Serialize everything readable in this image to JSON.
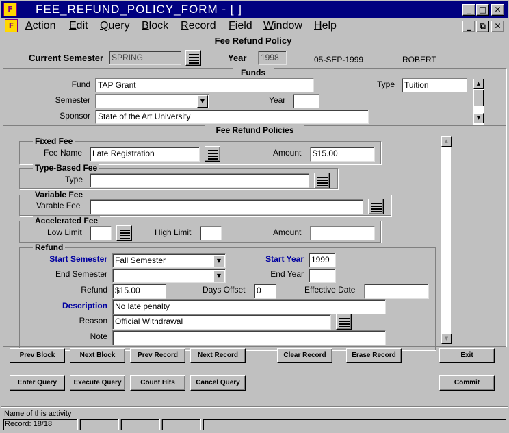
{
  "window": {
    "title": "FEE_REFUND_POLICY_FORM - [ ]",
    "icon_name": "oracle-forms-icon",
    "minimize": "_",
    "restore": "□",
    "close": "✕",
    "inner_restore": "⧉"
  },
  "menu": [
    "Action",
    "Edit",
    "Query",
    "Block",
    "Record",
    "Field",
    "Window",
    "Help"
  ],
  "form": {
    "title": "Fee Refund Policy",
    "current_semester_label": "Current Semester",
    "current_semester": "SPRING",
    "year_label": "Year",
    "year": "1998",
    "date": "05-SEP-1999",
    "user": "ROBERT"
  },
  "funds": {
    "header": "Funds",
    "fund_label": "Fund",
    "fund": "TAP Grant",
    "type_label": "Type",
    "type": "Tuition",
    "semester_label": "Semester",
    "semester": "",
    "year_label": "Year",
    "year": "",
    "sponsor_label": "Sponsor",
    "sponsor": "State of the Art University"
  },
  "policies": {
    "header": "Fee Refund Policies",
    "fixed_fee": {
      "title": "Fixed Fee",
      "fee_name_label": "Fee Name",
      "fee_name": "Late Registration",
      "amount_label": "Amount",
      "amount": "$15.00"
    },
    "type_based": {
      "title": "Type-Based Fee",
      "type_label": "Type",
      "type": ""
    },
    "variable": {
      "title": "Variable Fee",
      "label": "Varable Fee",
      "value": ""
    },
    "accelerated": {
      "title": "Accelerated Fee",
      "low_label": "Low Limit",
      "low": "",
      "high_label": "High Limit",
      "high": "",
      "amount_label": "Amount",
      "amount": ""
    },
    "refund": {
      "title": "Refund",
      "start_semester_label": "Start Semester",
      "start_semester": "Fall Semester",
      "start_year_label": "Start Year",
      "start_year": "1999",
      "end_semester_label": "End Semester",
      "end_semester": "",
      "end_year_label": "End Year",
      "end_year": "",
      "refund_label": "Refund",
      "refund": "$15.00",
      "days_offset_label": "Days Offset",
      "days_offset": "0",
      "effective_date_label": "Effective Date",
      "effective_date": "",
      "description_label": "Description",
      "description": "No late penalty",
      "reason_label": "Reason",
      "reason": "Official Withdrawal",
      "note_label": "Note",
      "note": ""
    }
  },
  "buttons": {
    "prev_block": "Prev Block",
    "next_block": "Next Block",
    "prev_record": "Prev Record",
    "next_record": "Next Record",
    "clear_record": "Clear Record",
    "erase_record": "Erase Record",
    "exit": "Exit",
    "enter_query": "Enter Query",
    "execute_query": "Execute Query",
    "count_hits": "Count Hits",
    "cancel_query": "Cancel Query",
    "commit": "Commit"
  },
  "status": {
    "message": "Name of this activity",
    "record": "Record: 18/18"
  },
  "icons": {
    "lov": "list-of-values-icon",
    "dropdown": "▼",
    "scroll_up": "▲",
    "scroll_down": "▼"
  },
  "colors": {
    "titlebar": "#000080",
    "face": "#c0c0c0",
    "required_label": "#0000a0"
  }
}
